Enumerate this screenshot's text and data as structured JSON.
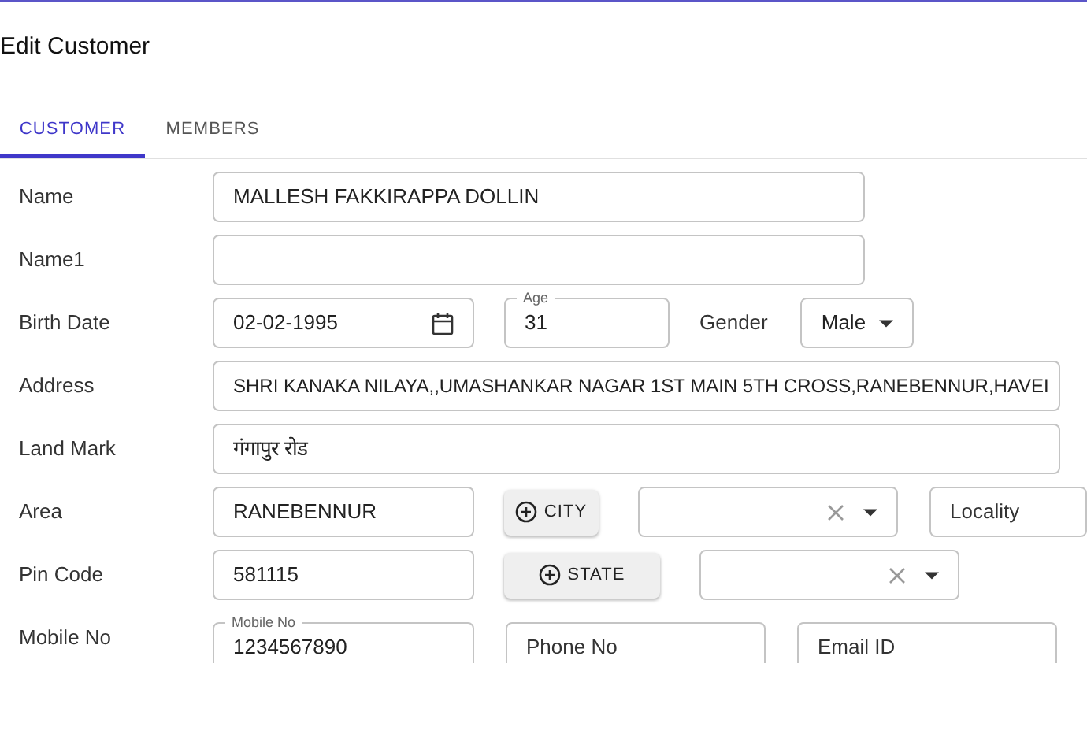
{
  "title": "Edit Customer",
  "tabs": [
    {
      "label": "CUSTOMER",
      "selected": true
    },
    {
      "label": "MEMBERS",
      "selected": false
    }
  ],
  "form": {
    "name": {
      "label": "Name",
      "value": "MALLESH FAKKIRAPPA DOLLIN"
    },
    "name1": {
      "label": "Name1"
    },
    "birth_date": {
      "label": "Birth Date",
      "value": "02-02-1995"
    },
    "age": {
      "label": "Age",
      "value": "31"
    },
    "gender": {
      "label": "Gender",
      "value": "Male"
    },
    "address": {
      "label": "Address",
      "value": "SHRI KANAKA NILAYA,,UMASHANKAR NAGAR 1ST MAIN 5TH CROSS,RANEBENNUR,HAVEI"
    },
    "landmark": {
      "label": "Land Mark",
      "value": "गंगापुर रोड"
    },
    "area": {
      "label": "Area",
      "value": "RANEBENNUR",
      "button": "CITY",
      "locality_placeholder": "Locality"
    },
    "pin_code": {
      "label": "Pin Code",
      "value": "581115",
      "button": "STATE"
    },
    "mobile": {
      "label": "Mobile No",
      "field_label": "Mobile No",
      "value": "1234567890",
      "phone_placeholder": "Phone No",
      "email_placeholder": "Email ID"
    }
  }
}
